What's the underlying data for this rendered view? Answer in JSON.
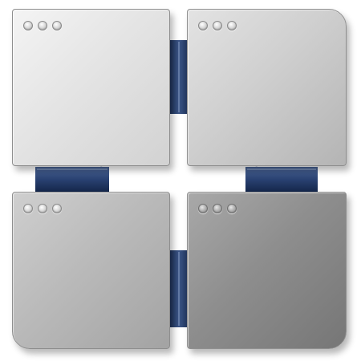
{
  "icon": {
    "name": "window-grid-icon",
    "colors": {
      "background": "#ffffff",
      "connector_navy": "#1f3460",
      "connector_highlight": "#6f85ad",
      "tile_light": "#f4f4f4",
      "tile_dark": "#767676"
    },
    "tiles": [
      {
        "position": "top-left",
        "window_dots": 3
      },
      {
        "position": "top-right",
        "window_dots": 3
      },
      {
        "position": "bottom-left",
        "window_dots": 3
      },
      {
        "position": "bottom-right",
        "window_dots": 3
      }
    ]
  }
}
